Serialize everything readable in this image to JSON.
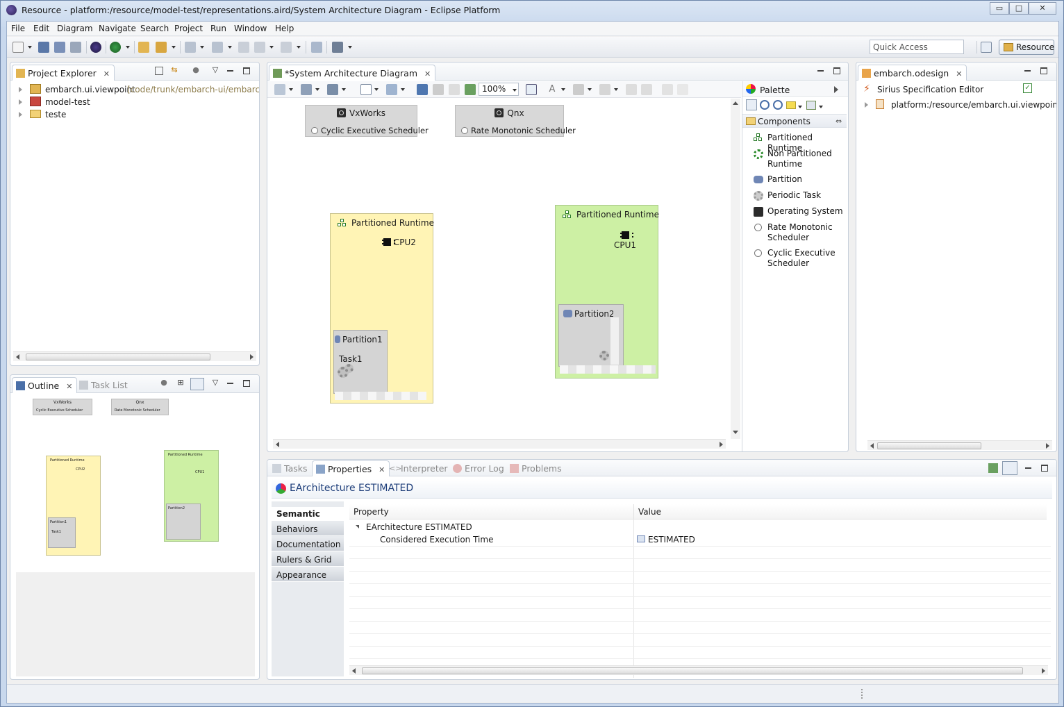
{
  "window": {
    "title": "Resource - platform:/resource/model-test/representations.aird/System Architecture Diagram - Eclipse Platform",
    "controls": [
      "▭",
      "□",
      "✕"
    ]
  },
  "menubar": [
    "File",
    "Edit",
    "Diagram",
    "Navigate",
    "Search",
    "Project",
    "Run",
    "Window",
    "Help"
  ],
  "toolbar": {
    "quick_access_placeholder": "Quick Access",
    "perspective_label": "Resource"
  },
  "project_explorer": {
    "tab_label": "Project Explorer",
    "items": [
      {
        "name": "embarch.ui.viewpoint",
        "decoration": "[code/trunk/embarch-ui/embarch."
      },
      {
        "name": "model-test",
        "decoration": ""
      },
      {
        "name": "teste",
        "decoration": ""
      }
    ]
  },
  "outline": {
    "tab_label": "Outline",
    "other_tab": "Task List",
    "mini": {
      "vxworks": "VxWorks",
      "vxworks_sched": "Cyclic Executive Scheduler",
      "qnx": "Qnx",
      "qnx_sched": "Rate Monotonic Scheduler",
      "rt1": "Partitioned Runtime",
      "rt1_cpu": "CPU2",
      "rt1_part": "Partition1",
      "rt1_task": "Task1",
      "rt2": "Partitioned Runtime",
      "rt2_cpu": "CPU1",
      "rt2_part": "Partition2"
    }
  },
  "editor": {
    "tab_label": "*System Architecture Diagram",
    "zoom": "100%",
    "nodes": {
      "vxworks": {
        "name": "VxWorks",
        "scheduler": "Cyclic Executive Scheduler"
      },
      "qnx": {
        "name": "Qnx",
        "scheduler": "Rate Monotonic Scheduler"
      },
      "runtime1": {
        "name": "Partitioned Runtime",
        "cpu": "CPU2",
        "partition": "Partition1",
        "task": "Task1"
      },
      "runtime2": {
        "name": "Partitioned Runtime",
        "cpu": "CPU1",
        "partition": "Partition2"
      }
    },
    "colors": {
      "runtime1_fill": "#fff4b5",
      "runtime2_fill": "#cdf0a4",
      "os_fill": "#d8d8d8"
    }
  },
  "palette": {
    "title": "Palette",
    "drawer": "Components",
    "items": [
      "Partitioned Runtime",
      "Non Partitioned Runtime",
      "Partition",
      "Periodic Task",
      "Operating System",
      "Rate Monotonic Scheduler",
      "Cyclic Executive Scheduler"
    ]
  },
  "odesign": {
    "tab_label": "embarch.odesign",
    "root": "Sirius Specification Editor",
    "child": "platform:/resource/embarch.ui.viewpoint/d"
  },
  "bottom": {
    "tabs": [
      "Tasks",
      "Properties",
      "Interpreter",
      "Error Log",
      "Problems"
    ],
    "header_title": "EArchitecture ESTIMATED",
    "categories": [
      "Semantic",
      "Behaviors",
      "Documentation",
      "Rulers & Grid",
      "Appearance"
    ],
    "columns": [
      "Property",
      "Value"
    ],
    "rows": [
      {
        "property": "EArchitecture ESTIMATED",
        "value": ""
      },
      {
        "property": "Considered Execution Time",
        "value": "ESTIMATED"
      }
    ]
  }
}
